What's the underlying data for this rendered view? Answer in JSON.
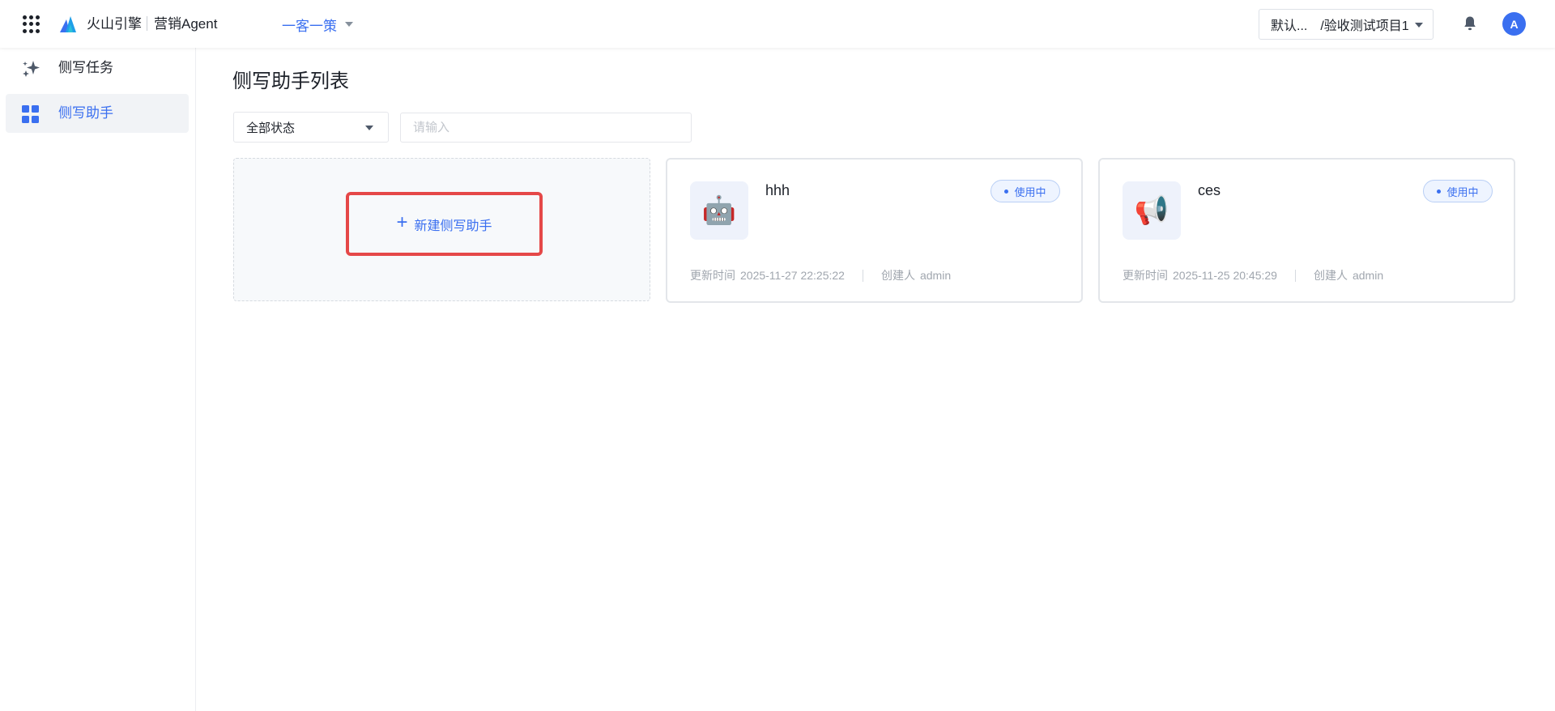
{
  "topbar": {
    "brand": "火山引擎",
    "product": "营销Agent",
    "nav_switch": "一客一策",
    "project_prefix": "默认...",
    "project_name": "/验收测试项目1",
    "avatar": "A",
    "icons": {
      "apps": "apps-grid-icon",
      "bell": "bell-icon"
    }
  },
  "sidebar": {
    "items": [
      {
        "label": "侧写任务",
        "icon": "sparkle-icon",
        "active": false
      },
      {
        "label": "侧写助手",
        "icon": "grid-icon",
        "active": true
      }
    ]
  },
  "main": {
    "title": "侧写助手列表",
    "filter_status": "全部状态",
    "search_placeholder": "请输入",
    "new_button": {
      "plus": "+",
      "label": "新建侧写助手"
    },
    "cards": [
      {
        "name": "hhh",
        "icon": "robot-icon",
        "icon_glyph": "🤖",
        "status": "使用中",
        "updated_label": "更新时间",
        "updated": "2025-11-27 22:25:22",
        "creator_label": "创建人",
        "creator": "admin"
      },
      {
        "name": "ces",
        "icon": "megaphone-icon",
        "icon_glyph": "📢",
        "status": "使用中",
        "updated_label": "更新时间",
        "updated": "2025-11-25 20:45:29",
        "creator_label": "创建人",
        "creator": "admin"
      }
    ]
  },
  "colors": {
    "accent": "#3a6ff0",
    "highlight": "#e54848"
  }
}
